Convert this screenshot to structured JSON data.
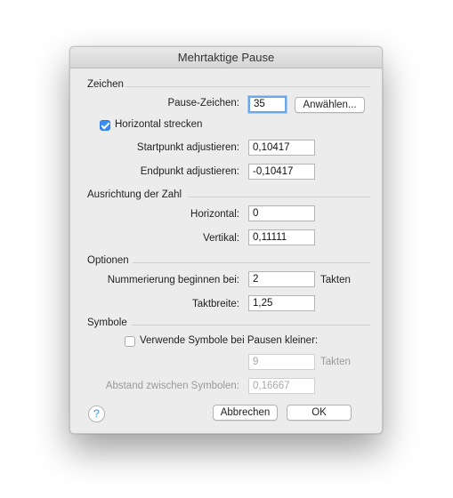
{
  "dialog": {
    "title": "Mehrtaktige Pause"
  },
  "sections": {
    "zeichen": "Zeichen",
    "ausrichtung": "Ausrichtung der Zahl",
    "optionen": "Optionen",
    "symbole": "Symbole"
  },
  "zeichen": {
    "pause_label": "Pause-Zeichen:",
    "pause_value": "35",
    "select_button": "Anwählen...",
    "stretch_label": "Horizontal strecken",
    "stretch_checked": true,
    "start_label": "Startpunkt adjustieren:",
    "start_value": "0,10417",
    "end_label": "Endpunkt adjustieren:",
    "end_value": "-0,10417"
  },
  "ausrichtung": {
    "horizontal_label": "Horizontal:",
    "horizontal_value": "0",
    "vertical_label": "Vertikal:",
    "vertical_value": "0,11111"
  },
  "optionen": {
    "numbering_label": "Nummerierung beginnen bei:",
    "numbering_value": "2",
    "numbering_unit": "Takten",
    "width_label": "Taktbreite:",
    "width_value": "1,25"
  },
  "symbole": {
    "use_symbols_label": "Verwende Symbole bei Pausen kleiner:",
    "use_symbols_checked": false,
    "threshold_value": "9",
    "threshold_unit": "Takten",
    "spacing_label": "Abstand zwischen Symbolen:",
    "spacing_value": "0,16667"
  },
  "footer": {
    "help": "?",
    "cancel": "Abbrechen",
    "ok": "OK"
  },
  "colors": {
    "accent": "#3b8ef5",
    "focus_ring": "#6aa6ea"
  }
}
